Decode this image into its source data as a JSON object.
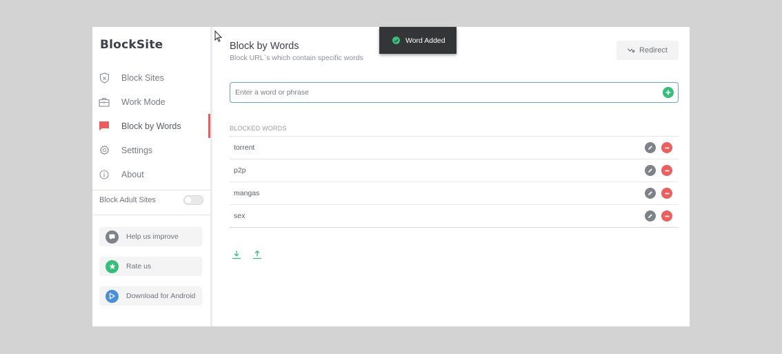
{
  "app": {
    "logo_text": "BlockSite"
  },
  "sidebar": {
    "items": [
      {
        "label": "Block Sites",
        "icon": "shield-icon"
      },
      {
        "label": "Work Mode",
        "icon": "briefcase-icon"
      },
      {
        "label": "Block by Words",
        "icon": "chat-bubble-icon",
        "active": true
      },
      {
        "label": "Settings",
        "icon": "gear-icon"
      },
      {
        "label": "About",
        "icon": "info-icon"
      }
    ],
    "adult_toggle": {
      "label": "Block Adult Sites",
      "enabled": false
    },
    "actions": [
      {
        "label": "Help us improve",
        "icon": "chat-icon",
        "color": "#7e8389"
      },
      {
        "label": "Rate us",
        "icon": "star-icon",
        "color": "#33c07a"
      },
      {
        "label": "Download for Android",
        "icon": "play-icon",
        "color": "#4a90d9"
      }
    ],
    "active_color": "#ef5b5b"
  },
  "main": {
    "title": "Block by Words",
    "subtitle": "Block URL`s which contain specific words",
    "redirect_label": "Redirect",
    "input": {
      "placeholder": "Enter a word or phrase",
      "value": ""
    },
    "blocked_header": "BLOCKED WORDS",
    "words": [
      "torrent",
      "p2p",
      "mangas",
      "sex"
    ]
  },
  "toast": {
    "text": "Word Added"
  },
  "colors": {
    "accent_green": "#33c07a",
    "input_border": "#5eaab7",
    "delete_red": "#ee5e5e"
  }
}
